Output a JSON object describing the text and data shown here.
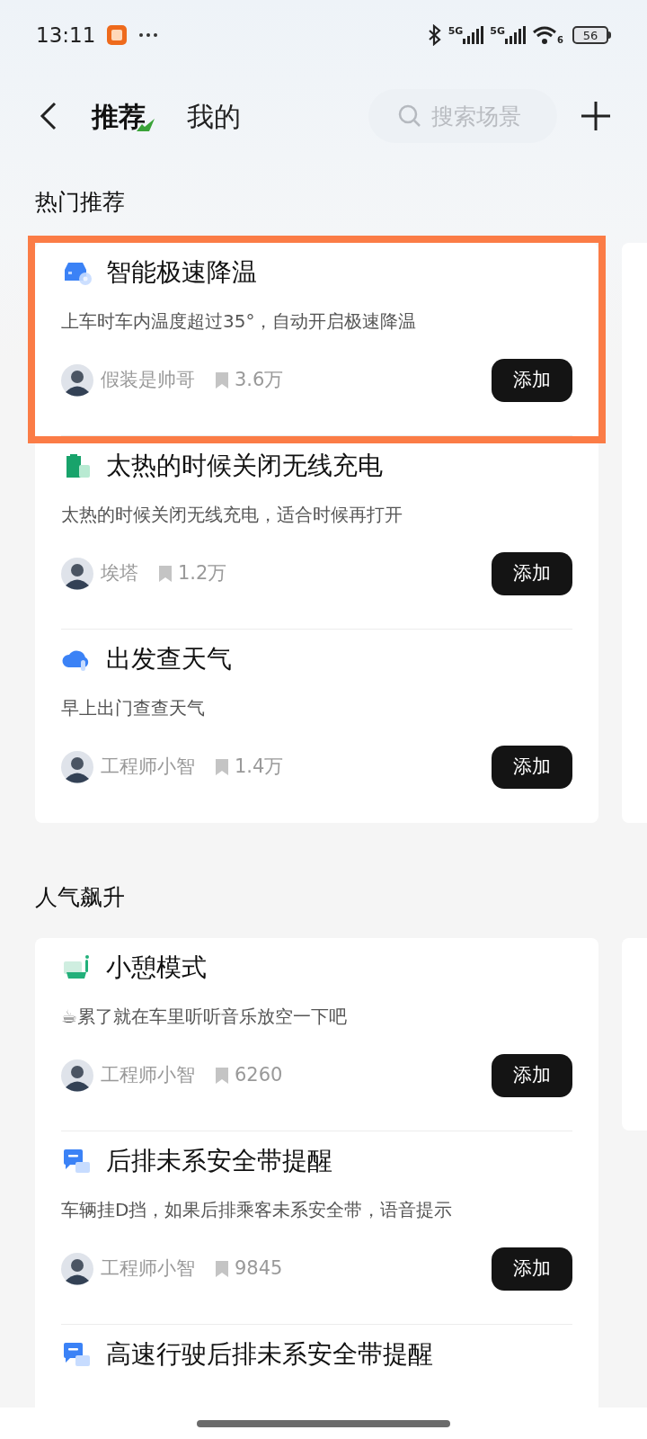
{
  "status_bar": {
    "time": "13:11",
    "network_1": "5G",
    "network_2": "5G",
    "wifi_label": "6",
    "battery": "56"
  },
  "header": {
    "tabs": [
      {
        "label": "推荐",
        "selected": true
      },
      {
        "label": "我的",
        "selected": false
      }
    ],
    "search": {
      "placeholder": "搜索场景"
    }
  },
  "sections": [
    {
      "title": "热门推荐",
      "items": [
        {
          "kind": "car",
          "title": "智能极速降温",
          "description": "上车时车内温度超过35°，自动开启极速降温",
          "author": "假装是帅哥",
          "saves": "3.6万",
          "button": "添加",
          "highlighted": true
        },
        {
          "kind": "charger",
          "title": "太热的时候关闭无线充电",
          "description": "太热的时候关闭无线充电，适合时候再打开",
          "author": "埃塔",
          "saves": "1.2万",
          "button": "添加",
          "highlighted": false
        },
        {
          "kind": "weather",
          "title": "出发查天气",
          "description": "早上出门查查天气",
          "author": "工程师小智",
          "saves": "1.4万",
          "button": "添加",
          "highlighted": false
        }
      ]
    },
    {
      "title": "人气飙升",
      "items": [
        {
          "kind": "rest",
          "title": "小憩模式",
          "description": "☕累了就在车里听听音乐放空一下吧",
          "author": "工程师小智",
          "saves": "6260",
          "button": "添加",
          "highlighted": false
        },
        {
          "kind": "message",
          "title": "后排未系安全带提醒",
          "description": "车辆挂D挡，如果后排乘客未系安全带，语音提示",
          "author": "工程师小智",
          "saves": "9845",
          "button": "添加",
          "highlighted": false
        },
        {
          "kind": "message",
          "title": "高速行驶后排未系安全带提醒",
          "highlighted": false
        }
      ]
    }
  ]
}
